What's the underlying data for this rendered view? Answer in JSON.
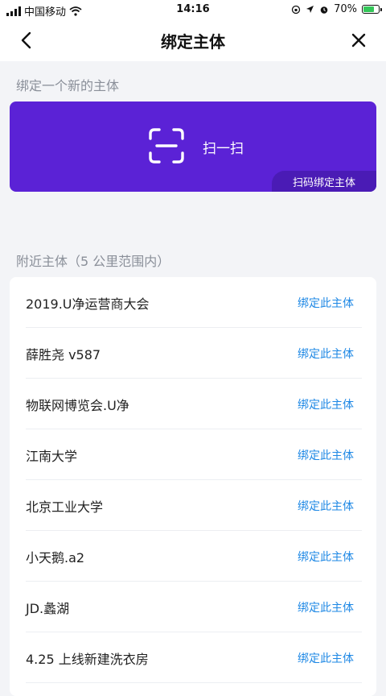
{
  "status_bar": {
    "carrier": "中国移动",
    "time": "14:16",
    "battery": "70%",
    "battery_level": 0.7,
    "icons": [
      "signal-icon",
      "wifi-icon",
      "orientation-lock-icon",
      "location-icon",
      "alarm-icon",
      "battery-icon"
    ]
  },
  "nav": {
    "title": "绑定主体",
    "back_icon": "chevron-left-icon",
    "close_icon": "close-icon"
  },
  "bind_section": {
    "label": "绑定一个新的主体"
  },
  "scan": {
    "label": "扫一扫",
    "badge": "扫码绑定主体",
    "icon": "scan-icon",
    "color": "#5b22d6"
  },
  "nearby": {
    "label": "附近主体（5 公里范围内）",
    "action_color": "#1e88e5",
    "items": [
      {
        "name": "2019.U净运营商大会",
        "action": "绑定此主体"
      },
      {
        "name": "薛胜尧 v587",
        "action": "绑定此主体"
      },
      {
        "name": "物联网博览会.U净",
        "action": "绑定此主体"
      },
      {
        "name": "江南大学",
        "action": "绑定此主体"
      },
      {
        "name": "北京工业大学",
        "action": "绑定此主体"
      },
      {
        "name": "小天鹅.a2",
        "action": "绑定此主体"
      },
      {
        "name": "JD.蠡湖",
        "action": "绑定此主体"
      },
      {
        "name": "4.25 上线新建洗衣房",
        "action": "绑定此主体"
      }
    ]
  }
}
